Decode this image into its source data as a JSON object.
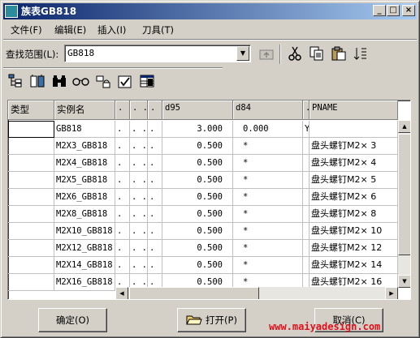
{
  "window": {
    "title": "族表GB818",
    "minimize": "_",
    "maximize": "□",
    "close": "×"
  },
  "menu": [
    {
      "label": "文件(F)"
    },
    {
      "label": "编辑(E)"
    },
    {
      "label": "插入(I)"
    },
    {
      "label": "刀具(T)"
    }
  ],
  "search": {
    "label": "查找范围(L):",
    "value": "GB818"
  },
  "toolbar_icons": [
    "up-folder-icon",
    "cut-icon",
    "copy-icon",
    "paste-icon",
    "sort-icon"
  ],
  "toolbar2_icons": [
    "tree-icon",
    "columns-icon",
    "binoculars-icon",
    "glasses-icon",
    "lock-icon",
    "verify-icon",
    "table-icon"
  ],
  "table": {
    "headers": [
      "类型",
      "实例名",
      ". .",
      ". .",
      ". .",
      "d95",
      "d84",
      ".",
      "PNAME"
    ],
    "rows": [
      [
        "",
        "GB818",
        ". .",
        ". .",
        ". .",
        "3.000",
        "0.000",
        "Y",
        ""
      ],
      [
        "",
        "M2X3_GB818",
        ". .",
        ". .",
        ". .",
        "0.500",
        "*",
        "",
        "盘头螺钉M2× 3"
      ],
      [
        "",
        "M2X4_GB818",
        ". .",
        ". .",
        ". .",
        "0.500",
        "*",
        "",
        "盘头螺钉M2× 4"
      ],
      [
        "",
        "M2X5_GB818",
        ". .",
        ". .",
        ". .",
        "0.500",
        "*",
        "",
        "盘头螺钉M2× 5"
      ],
      [
        "",
        "M2X6_GB818",
        ". .",
        ". .",
        ". .",
        "0.500",
        "*",
        "",
        "盘头螺钉M2× 6"
      ],
      [
        "",
        "M2X8_GB818",
        ". .",
        ". .",
        ". .",
        "0.500",
        "*",
        "",
        "盘头螺钉M2× 8"
      ],
      [
        "",
        "M2X10_GB818",
        ". .",
        ". .",
        ". .",
        "0.500",
        "*",
        "",
        "盘头螺钉M2× 10"
      ],
      [
        "",
        "M2X12_GB818",
        ". .",
        ". .",
        ". .",
        "0.500",
        "*",
        "",
        "盘头螺钉M2× 12"
      ],
      [
        "",
        "M2X14_GB818",
        ". .",
        ". .",
        ". .",
        "0.500",
        "*",
        "",
        "盘头螺钉M2× 14"
      ],
      [
        "",
        "M2X16_GB818",
        ". .",
        ". .",
        ". .",
        "0.500",
        "*",
        "",
        "盘头螺钉M2× 16"
      ]
    ]
  },
  "buttons": {
    "ok": "确定(O)",
    "open": "打开(P)",
    "cancel": "取消(C)"
  },
  "watermark": "www.maiyadesign.com"
}
